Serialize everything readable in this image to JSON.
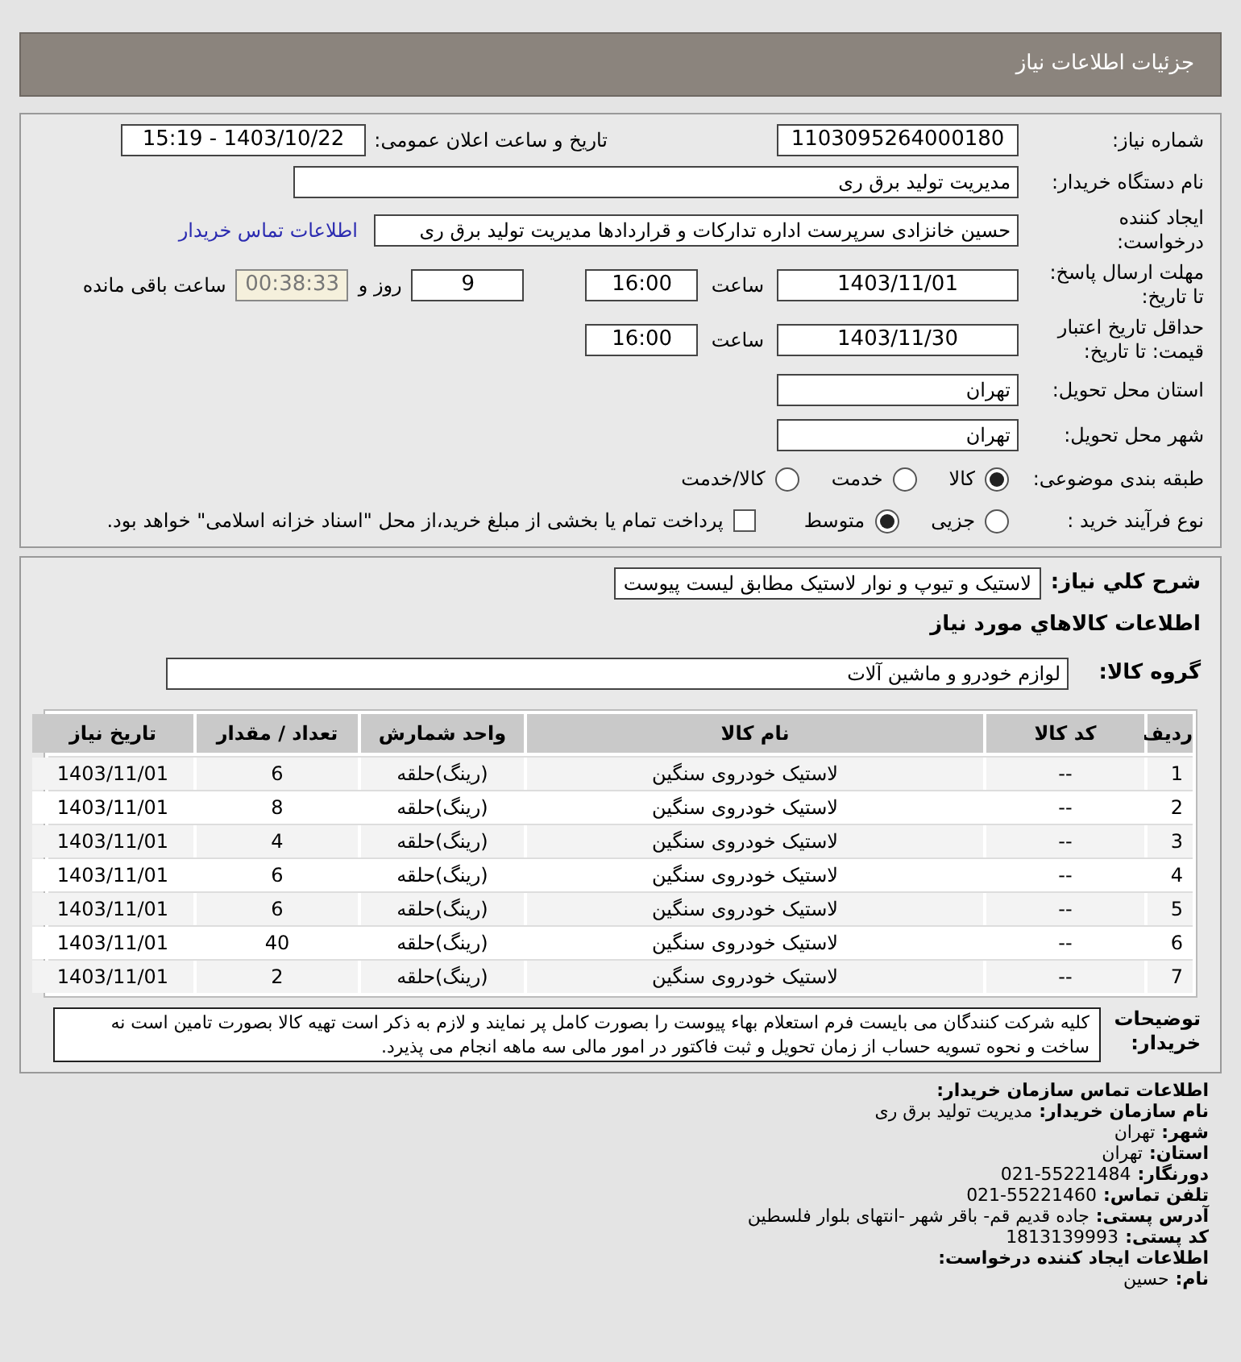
{
  "header": {
    "title": "جزئیات اطلاعات نیاز"
  },
  "details": {
    "need_number": {
      "label": "شماره نیاز:",
      "value": "1103095264000180"
    },
    "announcement": {
      "label": "تاریخ و ساعت اعلان عمومی:",
      "value": "1403/10/22 - 15:19"
    },
    "buyer_org": {
      "label": "نام دستگاه خریدار:",
      "value": "مدیریت تولید برق ری"
    },
    "creator": {
      "label": "ایجاد کننده\nدرخواست:",
      "value": "حسین خانزادی سرپرست اداره تدارکات و قراردادها مدیریت تولید برق ری",
      "link": "اطلاعات تماس خریدار"
    },
    "response_deadline": {
      "label": "مهلت ارسال پاسخ:\nتا تاریخ:",
      "date": "1403/11/01",
      "time_label": "ساعت",
      "time": "16:00",
      "days": "9",
      "days_label": "روز و",
      "remaining": "00:38:33",
      "remaining_label": "ساعت باقی مانده"
    },
    "price_validity": {
      "label": "حداقل تاریخ اعتبار\nقیمت: تا تاریخ:",
      "date": "1403/11/30",
      "time_label": "ساعت",
      "time": "16:00"
    },
    "province": {
      "label": "استان محل تحویل:",
      "value": "تهران"
    },
    "city": {
      "label": "شهر محل تحویل:",
      "value": "تهران"
    },
    "category": {
      "label": "طبقه بندی موضوعی:",
      "options": [
        {
          "label": "کالا",
          "selected": true
        },
        {
          "label": "خدمت",
          "selected": false
        },
        {
          "label": "کالا/خدمت",
          "selected": false
        }
      ]
    },
    "purchase_process": {
      "label": "نوع فرآیند خرید :",
      "options": [
        {
          "label": "جزیی",
          "selected": false
        },
        {
          "label": "متوسط",
          "selected": true
        }
      ],
      "treasury": {
        "checked": false,
        "text": "پرداخت تمام یا بخشی از مبلغ خرید،از محل \"اسناد خزانه اسلامی\" خواهد بود."
      }
    }
  },
  "needs": {
    "summary_label": "شرح کلي نياز:",
    "summary": "لاستیک و تیوپ و نوار لاستیک مطابق لیست پیوست",
    "goods_title": "اطلاعات کالاهاي مورد نياز",
    "group_label": "گروه کالا:",
    "group": "لوازم خودرو و ماشین آلات",
    "table": {
      "columns": [
        "ردیف",
        "کد کالا",
        "نام کالا",
        "واحد شمارش",
        "تعداد / مقدار",
        "تاریخ نیاز"
      ],
      "rows": [
        [
          "1",
          "--",
          "لاستیک خودروی سنگین",
          "(رینگ)حلقه",
          "6",
          "1403/11/01"
        ],
        [
          "2",
          "--",
          "لاستیک خودروی سنگین",
          "(رینگ)حلقه",
          "8",
          "1403/11/01"
        ],
        [
          "3",
          "--",
          "لاستیک خودروی سنگین",
          "(رینگ)حلقه",
          "4",
          "1403/11/01"
        ],
        [
          "4",
          "--",
          "لاستیک خودروی سنگین",
          "(رینگ)حلقه",
          "6",
          "1403/11/01"
        ],
        [
          "5",
          "--",
          "لاستیک خودروی سنگین",
          "(رینگ)حلقه",
          "6",
          "1403/11/01"
        ],
        [
          "6",
          "--",
          "لاستیک خودروی سنگین",
          "(رینگ)حلقه",
          "40",
          "1403/11/01"
        ],
        [
          "7",
          "--",
          "لاستیک خودروی سنگین",
          "(رینگ)حلقه",
          "2",
          "1403/11/01"
        ]
      ]
    },
    "notes_label": "توضیحات\nخریدار:",
    "notes": "کلیه شرکت کنندگان می بایست فرم استعلام بهاء پیوست را بصورت کامل پر نمایند و لازم به ذکر است تهیه کالا بصورت تامین است نه ساخت و نحوه تسویه حساب از زمان تحویل و ثبت فاکتور در امور مالی سه ماهه انجام می پذیرد."
  },
  "contact": {
    "title": "اطلاعات تماس سازمان خریدار:",
    "lines": [
      {
        "label": "نام سازمان خریدار:",
        "value": "مدیریت تولید برق ری"
      },
      {
        "label": "شهر:",
        "value": "تهران"
      },
      {
        "label": "استان:",
        "value": "تهران"
      },
      {
        "label": "دورنگار:",
        "value": "021-55221484"
      },
      {
        "label": "تلفن تماس:",
        "value": "021-55221460"
      },
      {
        "label": "آدرس پستی:",
        "value": "جاده قدیم قم- باقر شهر -انتهای بلوار فلسطین"
      },
      {
        "label": "کد پستی:",
        "value": "1813139993"
      }
    ],
    "creator_title": "اطلاعات ایجاد کننده درخواست:",
    "creator_line": {
      "label": "نام:",
      "value": "حسین"
    }
  }
}
